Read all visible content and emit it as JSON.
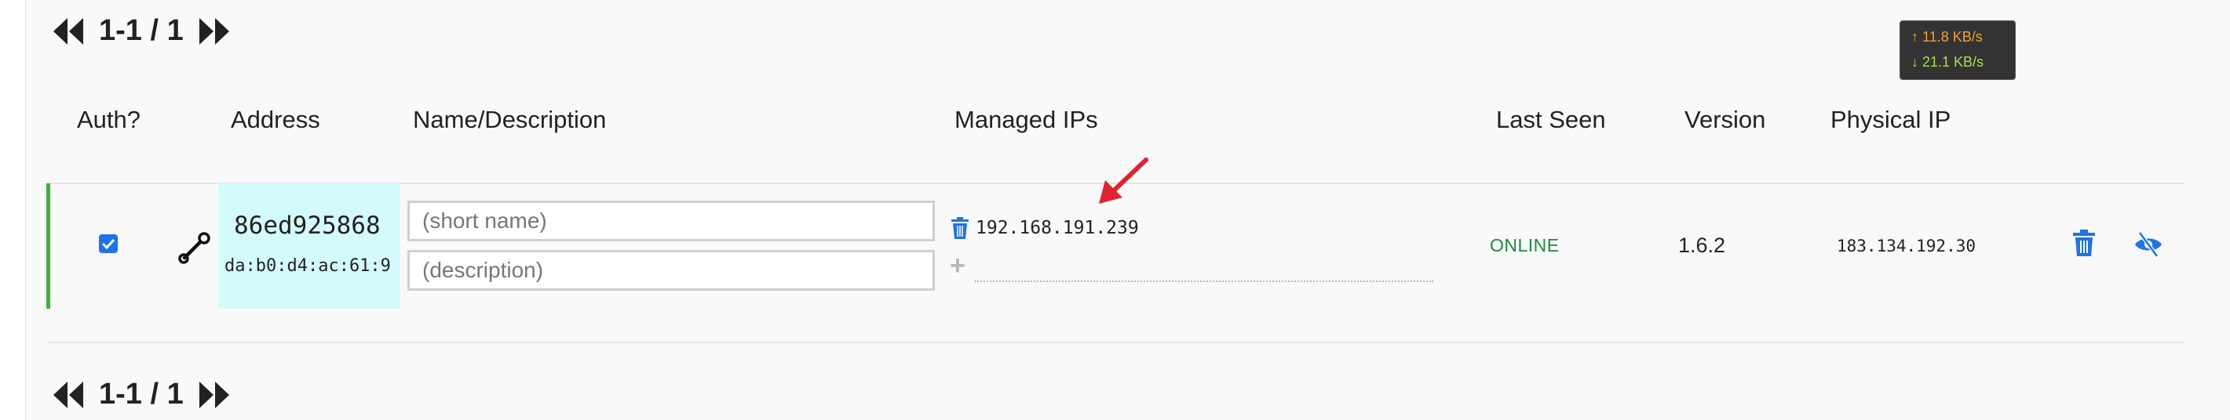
{
  "pagination": {
    "top_label": "1-1 / 1",
    "bottom_label": "1-1 / 1",
    "first_icon": "double-chevron-left-icon",
    "last_icon": "double-chevron-right-icon"
  },
  "network_widget": {
    "upload": "↑ 11.8 KB/s",
    "download": "↓ 21.1 KB/s",
    "upload_color": "#f3a32f",
    "download_color": "#a8df45"
  },
  "table": {
    "headers": {
      "auth": "Auth?",
      "address": "Address",
      "name_description": "Name/Description",
      "managed_ips": "Managed IPs",
      "last_seen": "Last Seen",
      "version": "Version",
      "physical_ip": "Physical IP"
    },
    "rows": [
      {
        "authorized": true,
        "address": "86ed925868",
        "mac": "da:b0:d4:ac:61:9",
        "name_placeholder": "(short name)",
        "description_placeholder": "(description)",
        "managed_ip": "192.168.191.239",
        "last_seen": "ONLINE",
        "version": "1.6.2",
        "physical_ip": "183.134.192.30",
        "row_accent_color": "#3bb33b",
        "address_bg_color": "#d4fbfc",
        "status_color": "#1f8a3e"
      }
    ]
  },
  "icons": {
    "auth_checkbox": "checkbox-checked-icon",
    "settings": "wrench-icon",
    "remove_ip": "trash-icon",
    "add_ip": "plus-icon",
    "delete_member": "trash-icon",
    "hide_member": "eye-slash-icon",
    "annotation": "red-arrow-icon"
  },
  "colors": {
    "action_blue": "#1e73e8",
    "annotation_red": "#e0242f"
  }
}
